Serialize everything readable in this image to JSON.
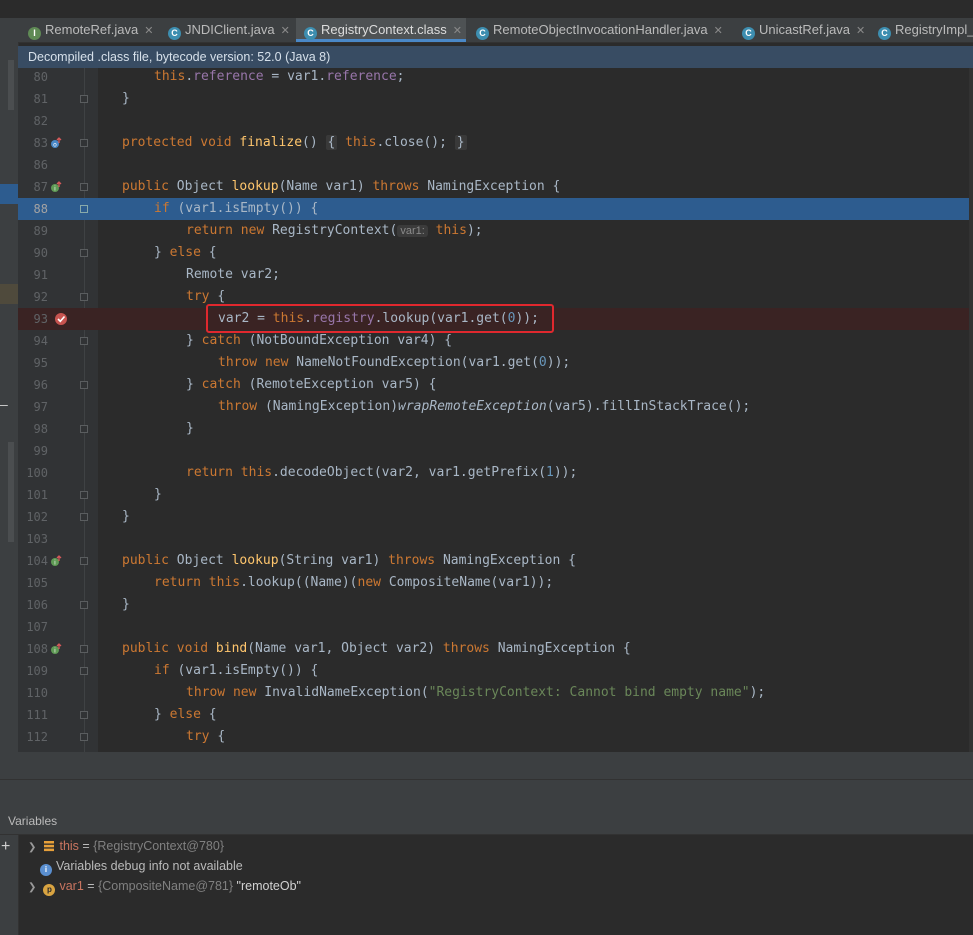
{
  "tabs": [
    {
      "label": "RemoteRef.java",
      "icon": "interface-icon",
      "active": false
    },
    {
      "label": "JNDIClient.java",
      "icon": "class-icon",
      "active": false
    },
    {
      "label": "RegistryContext.class",
      "icon": "class-icon",
      "active": true
    },
    {
      "label": "RemoteObjectInvocationHandler.java",
      "icon": "class-icon",
      "active": false
    },
    {
      "label": "UnicastRef.java",
      "icon": "class-icon",
      "active": false
    },
    {
      "label": "RegistryImpl_",
      "icon": "class-icon",
      "active": false
    }
  ],
  "info_bar": "Decompiled .class file, bytecode version: 52.0 (Java 8)",
  "editor": {
    "line_numbers": [
      "80",
      "81",
      "82",
      "83",
      "86",
      "87",
      "88",
      "89",
      "90",
      "91",
      "92",
      "93",
      "94",
      "95",
      "96",
      "97",
      "98",
      "99",
      "100",
      "101",
      "102",
      "103",
      "104",
      "105",
      "106",
      "107",
      "108",
      "109",
      "110",
      "111",
      "112"
    ],
    "highlighted_line": "88",
    "breakpoint_line": "93",
    "lines": {
      "80": {
        "text1": "this",
        "text2": ".",
        "text3": "reference",
        "text4": " = var1.",
        "text5": "reference",
        "text6": ";"
      },
      "81": {
        "text": "}"
      },
      "83": {
        "kw1": "protected void ",
        "fn": "finalize",
        "t1": "() ",
        "fold1": "{",
        "kw2": " this",
        "t2": ".close(); ",
        "fold2": "}"
      },
      "87": {
        "kw1": "public ",
        "t1": "Object ",
        "fn": "lookup",
        "t2": "(Name var1) ",
        "kw2": "throws ",
        "t3": "NamingException {"
      },
      "88": {
        "kw1": "if ",
        "t1": "(var1.isEmpty()) {"
      },
      "89": {
        "kw1": "return new ",
        "t1": "RegistryContext(",
        "hint": "var1:",
        "kw2": " this",
        "t2": ");"
      },
      "90": {
        "t1": "} ",
        "kw1": "else ",
        "t2": "{"
      },
      "91": {
        "t1": "Remote var2;"
      },
      "92": {
        "kw1": "try ",
        "t1": "{"
      },
      "93": {
        "t1": "var2 = ",
        "kw1": "this",
        "t2": ".",
        "fld": "registry",
        "t3": ".lookup(var1.get(",
        "num": "0",
        "t4": "));"
      },
      "94": {
        "t1": "} ",
        "kw1": "catch ",
        "t2": "(NotBoundException var4) {"
      },
      "95": {
        "kw1": "throw new ",
        "t1": "NameNotFoundException(var1.get(",
        "num": "0",
        "t2": "));"
      },
      "96": {
        "t1": "} ",
        "kw1": "catch ",
        "t2": "(RemoteException var5) {"
      },
      "97": {
        "kw1": "throw ",
        "t1": "(NamingException)",
        "it": "wrapRemoteException",
        "t2": "(var5).fillInStackTrace();"
      },
      "98": {
        "t1": "}"
      },
      "100": {
        "kw1": "return this",
        "t1": ".decodeObject(var2, var1.getPrefix(",
        "num": "1",
        "t2": "));"
      },
      "101": {
        "t1": "}"
      },
      "102": {
        "t1": "}"
      },
      "104": {
        "kw1": "public ",
        "t1": "Object ",
        "fn": "lookup",
        "t2": "(String var1) ",
        "kw2": "throws ",
        "t3": "NamingException {"
      },
      "105": {
        "kw1": "return this",
        "t1": ".lookup((Name)(",
        "kw2": "new ",
        "t2": "CompositeName(var1));"
      },
      "106": {
        "t1": "}"
      },
      "108": {
        "kw1": "public void ",
        "fn": "bind",
        "t1": "(Name var1, Object var2) ",
        "kw2": "throws ",
        "t2": "NamingException {"
      },
      "109": {
        "kw1": "if ",
        "t1": "(var1.isEmpty()) {"
      },
      "110": {
        "kw1": "throw new ",
        "t1": "InvalidNameException(",
        "str": "\"RegistryContext: Cannot bind empty name\"",
        "t2": ");"
      },
      "111": {
        "t1": "} ",
        "kw1": "else ",
        "t2": "{"
      },
      "112": {
        "kw1": "try ",
        "t1": "{"
      }
    }
  },
  "variables_panel": {
    "title": "Variables",
    "rows": [
      {
        "name": "this",
        "eq": " = ",
        "value": "{RegistryContext@780}",
        "icon": "field-icon"
      },
      {
        "text": "Variables debug info not available",
        "icon": "info-icon"
      },
      {
        "name": "var1",
        "eq": " = ",
        "value": "{CompositeName@781}",
        "str": " \"remoteOb\"",
        "icon": "parameter-icon"
      }
    ]
  },
  "colors": {
    "highlight": "#2d5c8f",
    "breakpoint": "#e0282e",
    "keyword": "#cc7832",
    "function": "#ffc66d",
    "field": "#9876aa"
  }
}
